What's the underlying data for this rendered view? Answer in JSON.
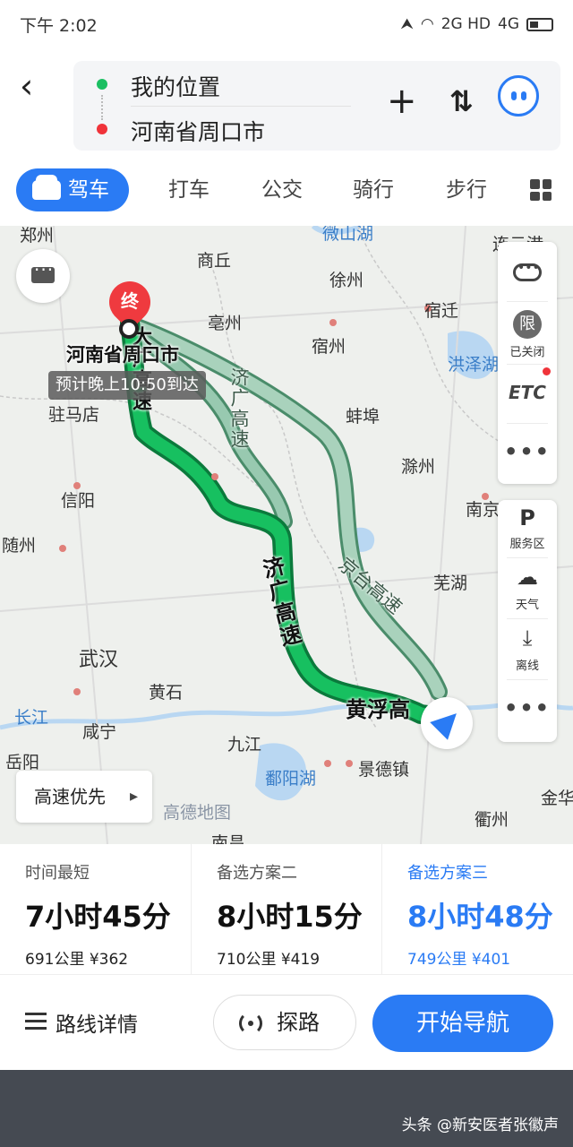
{
  "status_bar": {
    "time": "下午 2:02",
    "network": "2G HD",
    "network2": "4G"
  },
  "header": {
    "start": "我的位置",
    "end": "河南省周口市"
  },
  "tabs": {
    "drive": "驾车",
    "taxi": "打车",
    "bus": "公交",
    "bike": "骑行",
    "walk": "步行"
  },
  "map": {
    "cities": [
      "郑州",
      "商丘",
      "徐州",
      "连云港",
      "亳州",
      "宿迁",
      "宿州",
      "洪泽湖",
      "驻马店",
      "蚌埠",
      "滁州",
      "信阳",
      "南京",
      "随州",
      "芜湖",
      "武汉",
      "黄石",
      "长江",
      "咸宁",
      "九江",
      "岳阳",
      "鄱阳湖",
      "景德镇",
      "衢州",
      "金华",
      "南昌",
      "微山湖"
    ],
    "destination_pin": "终",
    "destination_label": "河南省周口市",
    "eta": "预计晚上10:50到达",
    "roads": {
      "main1": "大广高速",
      "main2": "济广高速",
      "main3": "黄浮高",
      "alt1": "济广高速",
      "alt2": "京台高速"
    },
    "side": {
      "limit": "限",
      "limit_status": "已关闭",
      "etc": "ETC",
      "service": "服务区",
      "weather": "天气",
      "offline": "离线",
      "more": "•••"
    },
    "priority_button": "高速优先",
    "watermark": "高德地图"
  },
  "routes": [
    {
      "label": "时间最短",
      "time": "7小时45分",
      "meta": "691公里 ¥362"
    },
    {
      "label": "备选方案二",
      "time": "8小时15分",
      "meta": "710公里 ¥419"
    },
    {
      "label": "备选方案三",
      "time": "8小时48分",
      "meta": "749公里 ¥401"
    }
  ],
  "actions": {
    "details": "路线详情",
    "probe": "探路",
    "navigate": "开始导航"
  },
  "footer": {
    "watermark": "头条 @新安医者张徽声"
  },
  "colors": {
    "accent": "#2a7bf4",
    "route_main": "#15b25a",
    "route_alt": "#8fc6a9"
  }
}
